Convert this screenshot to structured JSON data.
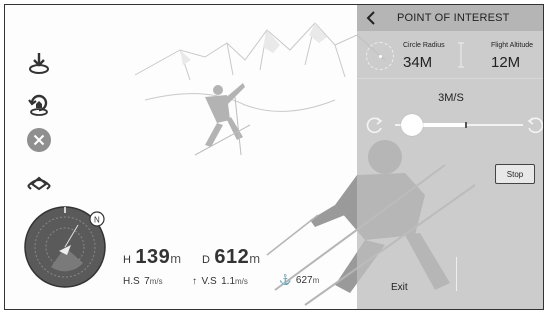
{
  "left_toolbar": {
    "icons": [
      "takeoff-icon",
      "return-home-icon",
      "close-icon",
      "intelligent-flight-icon"
    ]
  },
  "radar": {
    "north_label": "N"
  },
  "telemetry": {
    "h_label": "H",
    "h_value": "139",
    "h_unit": "m",
    "d_label": "D",
    "d_value": "612",
    "d_unit": "m",
    "hs_label": "H.S",
    "hs_value": "7",
    "hs_unit": "m/s",
    "vs_label": "V.S",
    "vs_value": "1.1",
    "vs_unit": "m/s",
    "home_value": "627",
    "home_unit": "m"
  },
  "panel": {
    "title": "POINT OF INTEREST",
    "radius_label": "Circle Radius",
    "radius_value": "34M",
    "altitude_label": "Flight Altitude",
    "altitude_value": "12M",
    "speed": "3M/S",
    "speed_fraction": 0.2,
    "stop_label": "Stop",
    "exit_label": "Exit"
  },
  "colors": {
    "panel_bg": "#bebebe",
    "panel_header": "#b5b5b5",
    "radar_fill": "#5a5a5a"
  }
}
